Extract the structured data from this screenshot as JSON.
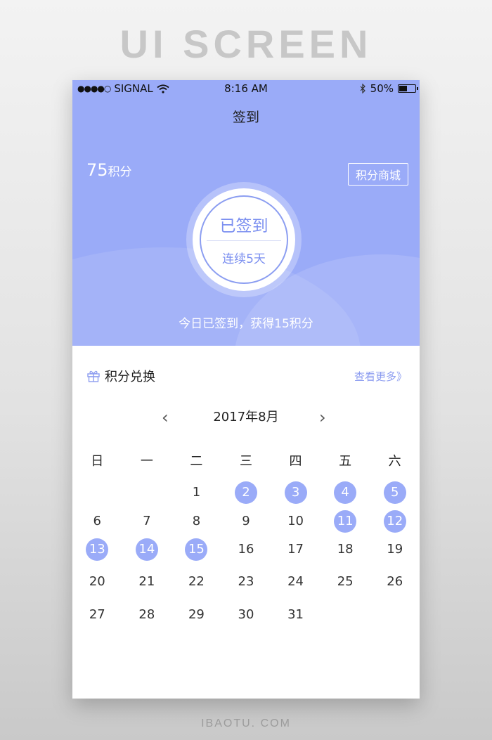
{
  "banner": "UI SCREEN",
  "status_bar": {
    "carrier_dots": "●●●●○",
    "carrier": "SIGNAL",
    "time": "8:16 AM",
    "battery": "50%",
    "battery_level": 0.5
  },
  "nav": {
    "title": "签到"
  },
  "header": {
    "points_value": "75",
    "points_unit": "积分",
    "mall_button": "积分商城",
    "signed_status": "已签到",
    "streak": "连续5天",
    "today_message": "今日已签到，获得15积分"
  },
  "exchange": {
    "title": "积分兑换",
    "more": "查看更多》"
  },
  "calendar": {
    "month_label": "2017年8月",
    "prev": "‹",
    "next": "›",
    "weekdays": [
      "日",
      "一",
      "二",
      "三",
      "四",
      "五",
      "六"
    ],
    "first_weekday": 2,
    "days": [
      {
        "d": "1",
        "signed": false
      },
      {
        "d": "2",
        "signed": true
      },
      {
        "d": "3",
        "signed": true
      },
      {
        "d": "4",
        "signed": true
      },
      {
        "d": "5",
        "signed": true
      },
      {
        "d": "6",
        "signed": false
      },
      {
        "d": "7",
        "signed": false
      },
      {
        "d": "8",
        "signed": false
      },
      {
        "d": "9",
        "signed": false
      },
      {
        "d": "10",
        "signed": false
      },
      {
        "d": "11",
        "signed": true
      },
      {
        "d": "12",
        "signed": true
      },
      {
        "d": "13",
        "signed": true
      },
      {
        "d": "14",
        "signed": true
      },
      {
        "d": "15",
        "signed": true
      },
      {
        "d": "16",
        "signed": false
      },
      {
        "d": "17",
        "signed": false
      },
      {
        "d": "18",
        "signed": false
      },
      {
        "d": "19",
        "signed": false
      },
      {
        "d": "20",
        "signed": false
      },
      {
        "d": "21",
        "signed": false
      },
      {
        "d": "22",
        "signed": false
      },
      {
        "d": "23",
        "signed": false
      },
      {
        "d": "24",
        "signed": false
      },
      {
        "d": "25",
        "signed": false
      },
      {
        "d": "26",
        "signed": false
      },
      {
        "d": "27",
        "signed": false
      },
      {
        "d": "28",
        "signed": false
      },
      {
        "d": "29",
        "signed": false
      },
      {
        "d": "30",
        "signed": false
      },
      {
        "d": "31",
        "signed": false
      }
    ]
  },
  "footer": "IBAOTU. COM",
  "colors": {
    "accent": "#9aabf8",
    "accent_text": "#7b8ff0"
  },
  "icons": {
    "gift": "gift-icon",
    "wifi": "wifi-icon",
    "bluetooth": "bluetooth-icon",
    "battery": "battery-icon"
  }
}
